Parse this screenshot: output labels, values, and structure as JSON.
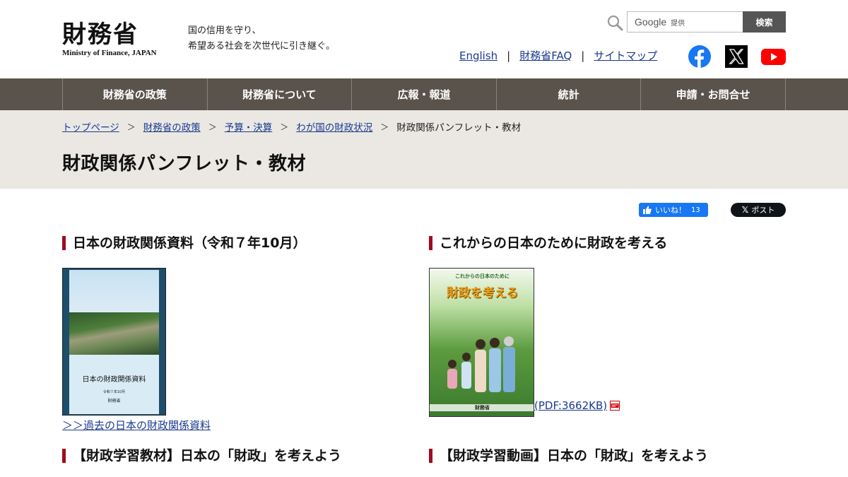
{
  "header": {
    "logo_jp": "財務省",
    "logo_en": "Ministry of Finance, JAPAN",
    "tagline_line1": "国の信用を守り、",
    "tagline_line2": "希望ある社会を次世代に引き継ぐ。",
    "search": {
      "provider": "Google",
      "provided_label": "提供",
      "button_label": "検索"
    },
    "util_links": [
      "English",
      "財務省FAQ",
      "サイトマップ"
    ],
    "util_separator": "|",
    "social_icons": [
      "facebook-icon",
      "x-icon",
      "youtube-icon"
    ]
  },
  "nav": {
    "items": [
      "財務省の政策",
      "財務省について",
      "広報・報道",
      "統計",
      "申請・お問合せ"
    ]
  },
  "breadcrumb": {
    "items": [
      "トップページ",
      "財務省の政策",
      "予算・決算",
      "わが国の財政状況"
    ],
    "separator": "＞",
    "current": "財政関係パンフレット・教材"
  },
  "page_title": "財政関係パンフレット・教材",
  "share": {
    "like_label": "いいね！",
    "like_count": "13",
    "post_label": "ポスト"
  },
  "sections": {
    "s1": {
      "title": "日本の財政関係資料（令和７年10月）",
      "cover_title": "日本の財政関係資料",
      "cover_sub": "令和７年10月",
      "cover_org": "財務省",
      "past_link": "＞＞過去の日本の財政関係資料"
    },
    "s2": {
      "title": "これからの日本のために財政を考える",
      "cover_top": "これからの日本のために",
      "cover_big": "財政を考える",
      "cover_org": "財務省",
      "pdf_link": "(PDF:3662KB)"
    },
    "s3": {
      "title": "【財政学習教材】日本の「財政」を考えよう"
    },
    "s4": {
      "title": "【財政学習動画】日本の「財政」を考えよう"
    }
  },
  "colors": {
    "nav_bg": "#5a534b",
    "band_bg": "#ebe8e4",
    "accent_bar": "#a00a1f",
    "link": "#1a3a8f",
    "facebook": "#1877f2",
    "youtube": "#ff0000"
  }
}
